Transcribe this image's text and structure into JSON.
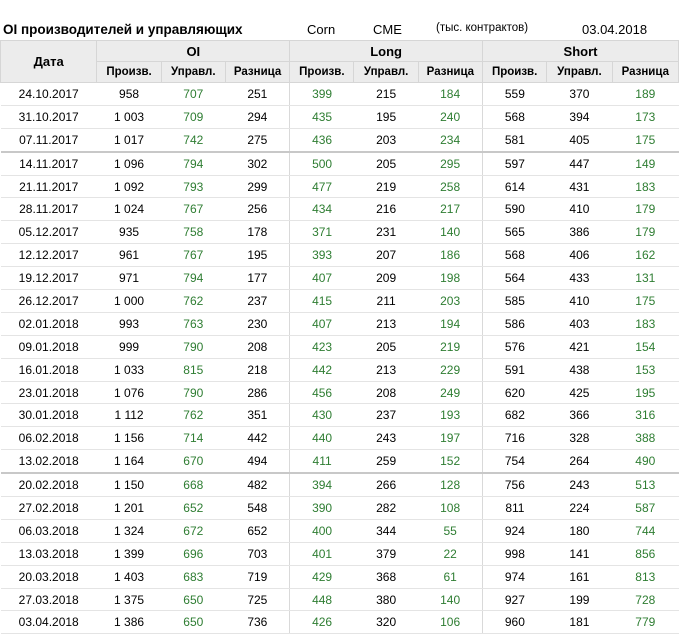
{
  "title": {
    "main": "OI производителей и управляющих",
    "commodity": "Corn",
    "exchange": "CME",
    "units": "(тыс. контрактов)",
    "date": "03.04.2018"
  },
  "headers": {
    "date": "Дата",
    "groups": [
      "OI",
      "Long",
      "Short"
    ],
    "sub": [
      "Произв.",
      "Управл.",
      "Разница",
      "Произв.",
      "Управл.",
      "Разница",
      "Произв.",
      "Управл.",
      "Разница"
    ]
  },
  "rows": [
    [
      "24.10.2017",
      "958",
      "707",
      "251",
      "399",
      "215",
      "184",
      "559",
      "370",
      "189"
    ],
    [
      "31.10.2017",
      "1 003",
      "709",
      "294",
      "435",
      "195",
      "240",
      "568",
      "394",
      "173"
    ],
    [
      "07.11.2017",
      "1 017",
      "742",
      "275",
      "436",
      "203",
      "234",
      "581",
      "405",
      "175"
    ],
    [
      "14.11.2017",
      "1 096",
      "794",
      "302",
      "500",
      "205",
      "295",
      "597",
      "447",
      "149"
    ],
    [
      "21.11.2017",
      "1 092",
      "793",
      "299",
      "477",
      "219",
      "258",
      "614",
      "431",
      "183"
    ],
    [
      "28.11.2017",
      "1 024",
      "767",
      "256",
      "434",
      "216",
      "217",
      "590",
      "410",
      "179"
    ],
    [
      "05.12.2017",
      "935",
      "758",
      "178",
      "371",
      "231",
      "140",
      "565",
      "386",
      "179"
    ],
    [
      "12.12.2017",
      "961",
      "767",
      "195",
      "393",
      "207",
      "186",
      "568",
      "406",
      "162"
    ],
    [
      "19.12.2017",
      "971",
      "794",
      "177",
      "407",
      "209",
      "198",
      "564",
      "433",
      "131"
    ],
    [
      "26.12.2017",
      "1 000",
      "762",
      "237",
      "415",
      "211",
      "203",
      "585",
      "410",
      "175"
    ],
    [
      "02.01.2018",
      "993",
      "763",
      "230",
      "407",
      "213",
      "194",
      "586",
      "403",
      "183"
    ],
    [
      "09.01.2018",
      "999",
      "790",
      "208",
      "423",
      "205",
      "219",
      "576",
      "421",
      "154"
    ],
    [
      "16.01.2018",
      "1 033",
      "815",
      "218",
      "442",
      "213",
      "229",
      "591",
      "438",
      "153"
    ],
    [
      "23.01.2018",
      "1 076",
      "790",
      "286",
      "456",
      "208",
      "249",
      "620",
      "425",
      "195"
    ],
    [
      "30.01.2018",
      "1 112",
      "762",
      "351",
      "430",
      "237",
      "193",
      "682",
      "366",
      "316"
    ],
    [
      "06.02.2018",
      "1 156",
      "714",
      "442",
      "440",
      "243",
      "197",
      "716",
      "328",
      "388"
    ],
    [
      "13.02.2018",
      "1 164",
      "670",
      "494",
      "411",
      "259",
      "152",
      "754",
      "264",
      "490"
    ],
    [
      "20.02.2018",
      "1 150",
      "668",
      "482",
      "394",
      "266",
      "128",
      "756",
      "243",
      "513"
    ],
    [
      "27.02.2018",
      "1 201",
      "652",
      "548",
      "390",
      "282",
      "108",
      "811",
      "224",
      "587"
    ],
    [
      "06.03.2018",
      "1 324",
      "672",
      "652",
      "400",
      "344",
      "55",
      "924",
      "180",
      "744"
    ],
    [
      "13.03.2018",
      "1 399",
      "696",
      "703",
      "401",
      "379",
      "22",
      "998",
      "141",
      "856"
    ],
    [
      "20.03.2018",
      "1 403",
      "683",
      "719",
      "429",
      "368",
      "61",
      "974",
      "161",
      "813"
    ],
    [
      "27.03.2018",
      "1 375",
      "650",
      "725",
      "448",
      "380",
      "140",
      "927",
      "199",
      "728"
    ],
    [
      "03.04.2018",
      "1 386",
      "650",
      "736",
      "426",
      "320",
      "106",
      "960",
      "181",
      "779"
    ]
  ],
  "separator_rows": [
    3,
    17
  ],
  "colors": {
    "green": "#2e7d32",
    "header_bg": "#ececec"
  }
}
